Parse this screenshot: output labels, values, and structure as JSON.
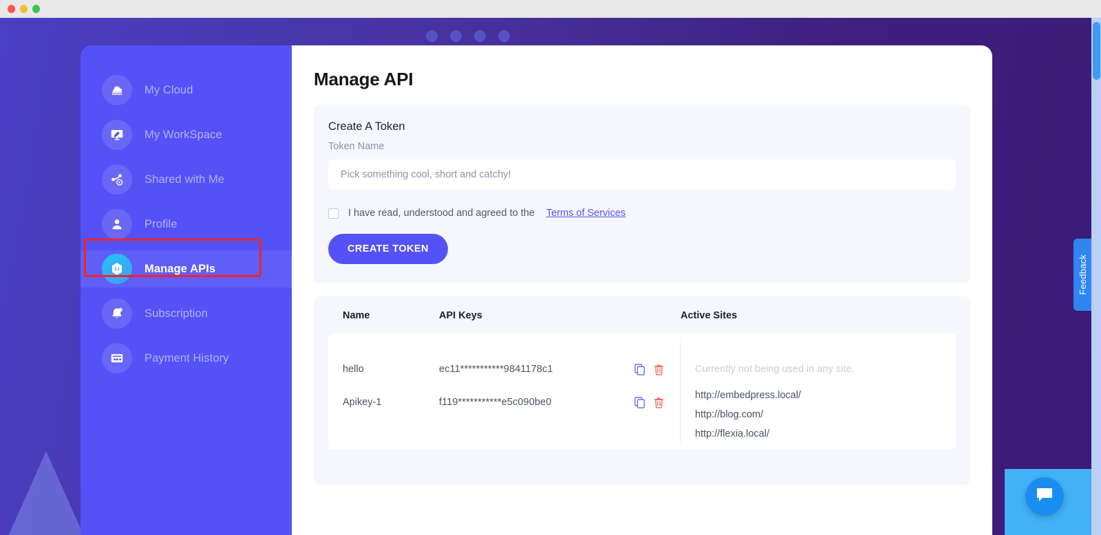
{
  "window": {
    "traffic_lights": [
      "close",
      "minimize",
      "maximize"
    ]
  },
  "sidebar": {
    "items": [
      {
        "label": "My Cloud",
        "icon": "cloud-icon",
        "active": false
      },
      {
        "label": "My WorkSpace",
        "icon": "workspace-icon",
        "active": false
      },
      {
        "label": "Shared with Me",
        "icon": "share-icon",
        "active": false
      },
      {
        "label": "Profile",
        "icon": "user-icon",
        "active": false
      },
      {
        "label": "Manage APIs",
        "icon": "api-hexagon-icon",
        "active": true
      },
      {
        "label": "Subscription",
        "icon": "bell-icon",
        "active": false
      },
      {
        "label": "Payment History",
        "icon": "card-icon",
        "active": false
      }
    ]
  },
  "main": {
    "page_title": "Manage API",
    "create_token": {
      "card_title": "Create A Token",
      "field_label": "Token Name",
      "input_value": "",
      "input_placeholder": "Pick something cool, short and catchy!",
      "agree_text": "I have read, understood and agreed to the",
      "tos_link": "Terms of Services",
      "checkbox_checked": false,
      "submit_label": "CREATE TOKEN"
    },
    "table": {
      "headers": {
        "name": "Name",
        "keys": "API Keys",
        "sites": "Active Sites"
      },
      "rows": [
        {
          "name": "hello",
          "api_key": "ec11***********9841178c1",
          "copy_icon": "copy-icon",
          "delete_icon": "trash-icon",
          "sites_empty_text": "Currently not being used in any site.",
          "sites": []
        },
        {
          "name": "Apikey-1",
          "api_key": "f119***********e5c090be0",
          "copy_icon": "copy-icon",
          "delete_icon": "trash-icon",
          "sites_empty_text": "",
          "sites": [
            "http://embedpress.local/",
            "http://blog.com/",
            "http://flexia.local/"
          ]
        }
      ]
    }
  },
  "widgets": {
    "feedback_label": "Feedback",
    "chat_icon": "chat-bubble-icon"
  },
  "colors": {
    "brand_indigo": "#5451f6",
    "page_purple_start": "#4b3fc4",
    "page_purple_end": "#3c1a78",
    "accent_cyan": "#27c3f3",
    "highlight_red": "#f5231f",
    "delete_red": "#f4615c",
    "card_bg": "#f6f7fd",
    "feedback_blue": "#2f86f0",
    "chat_blue": "#1a8df0"
  }
}
